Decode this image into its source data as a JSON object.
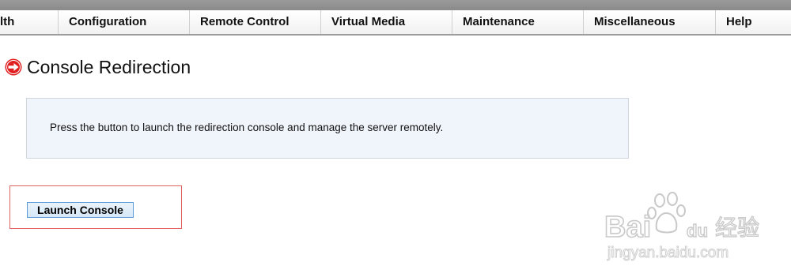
{
  "nav": {
    "items": [
      {
        "label": "lth"
      },
      {
        "label": "Configuration"
      },
      {
        "label": "Remote Control"
      },
      {
        "label": "Virtual Media"
      },
      {
        "label": "Maintenance"
      },
      {
        "label": "Miscellaneous"
      },
      {
        "label": "Help"
      }
    ]
  },
  "page": {
    "title": "Console Redirection",
    "title_icon": "red-arrow-circle-icon"
  },
  "info": {
    "text": "Press the button to launch the redirection console and manage the server remotely."
  },
  "launch_button": {
    "label": "Launch Console"
  },
  "watermark": {
    "brand": "Baidu",
    "chinese": "经验",
    "url": "jingyan.baidu.com"
  },
  "colors": {
    "accent_red": "#e02020",
    "info_bg": "#f0f4fb",
    "button_border": "#5a9ad6",
    "highlight_frame": "#e06060"
  }
}
